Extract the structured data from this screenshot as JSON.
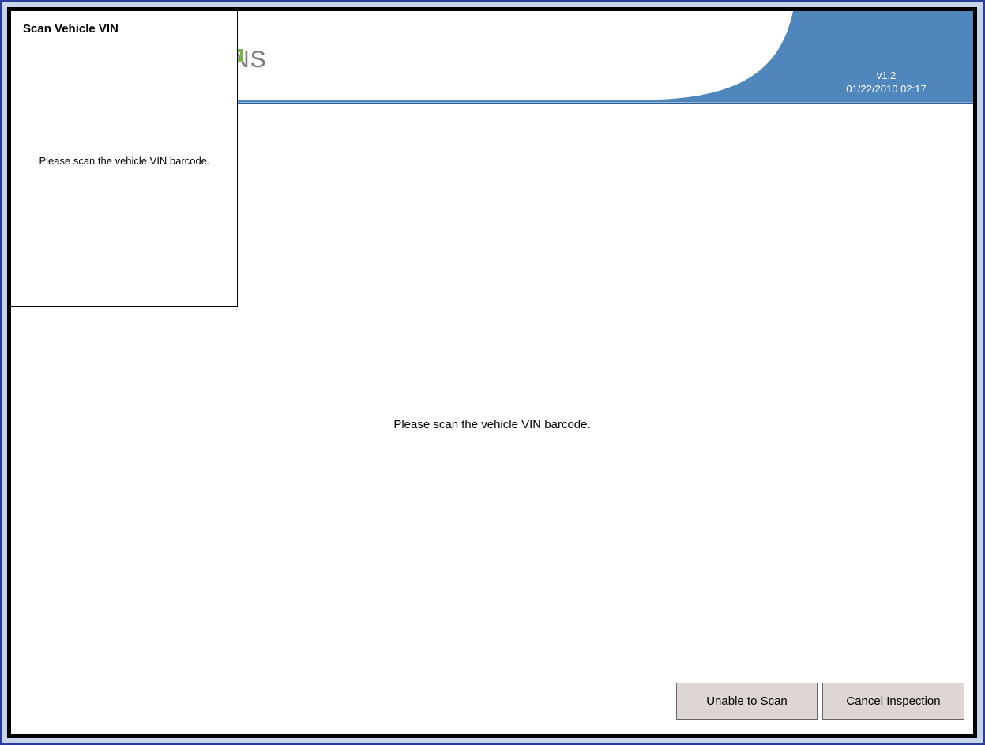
{
  "header": {
    "logo_text": "NS",
    "version": "v1.2",
    "datetime": "01/22/2010 02:17",
    "accent_color": "#4f87bd"
  },
  "popup": {
    "title": "Scan Vehicle VIN",
    "message": "Please scan the vehicle VIN barcode."
  },
  "main": {
    "message": "Please scan the vehicle VIN barcode."
  },
  "buttons": {
    "unable_label": "Unable to Scan",
    "cancel_label": "Cancel Inspection"
  }
}
